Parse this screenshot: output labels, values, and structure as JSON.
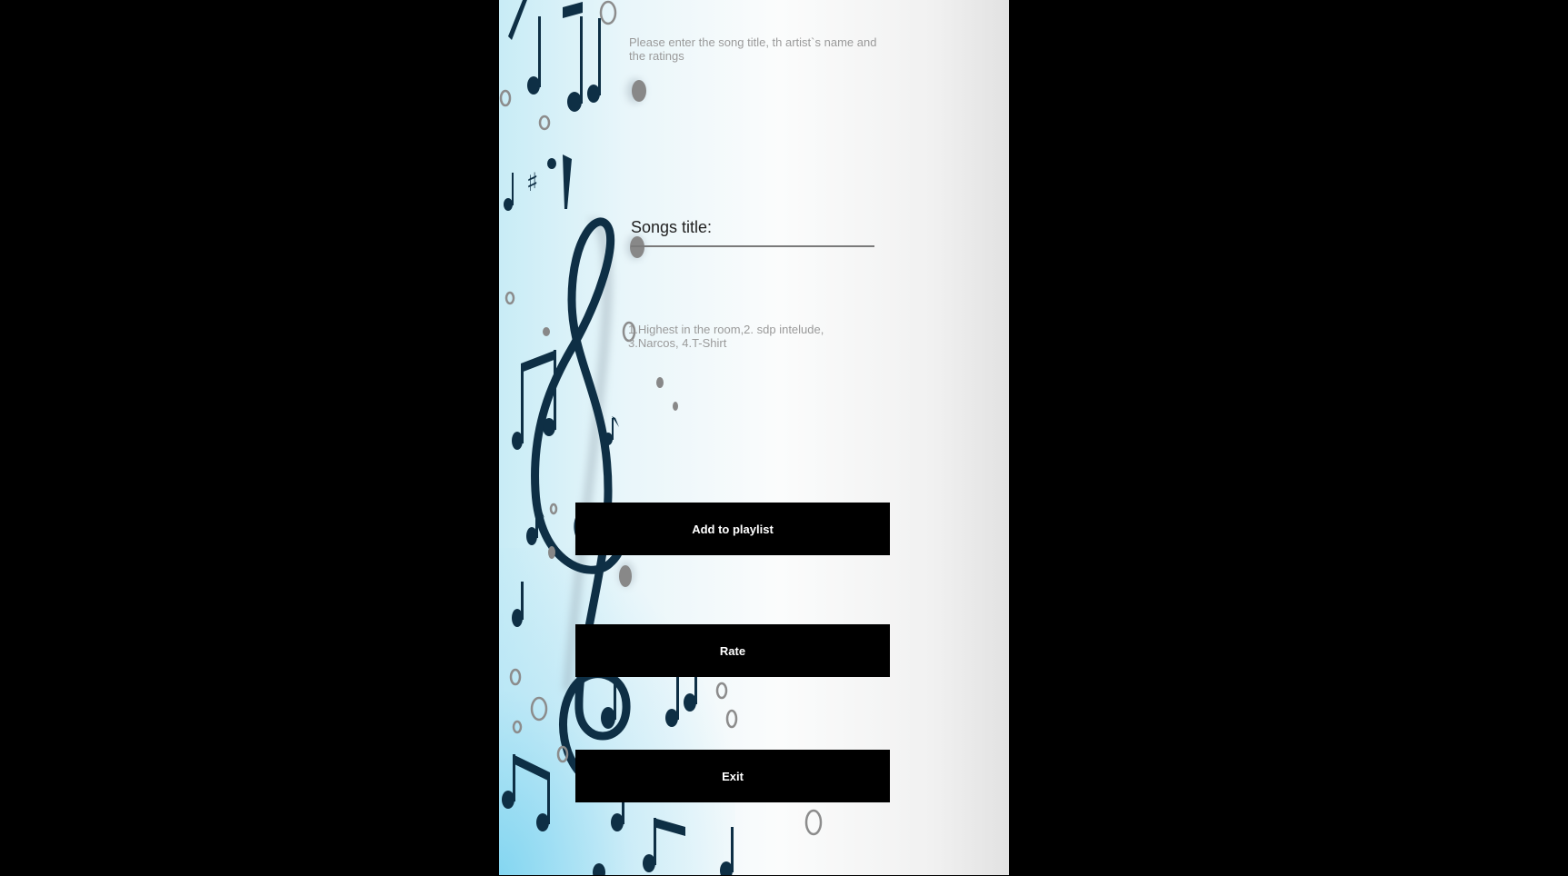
{
  "form": {
    "instruction": "Please enter the song title, th artist`s name and the ratings",
    "song_title_placeholder": "Songs title:",
    "songs_list_hint": "1.Highest in the room,2. sdp intelude, 3.Narcos, 4.T-Shirt"
  },
  "buttons": {
    "add_to_playlist": "Add to playlist",
    "rate": "Rate",
    "exit": "Exit"
  },
  "background": {
    "motif": "music-notes-treble-clef",
    "note_color": "#0e2f45",
    "accent_blue": "#7fd3ef"
  }
}
